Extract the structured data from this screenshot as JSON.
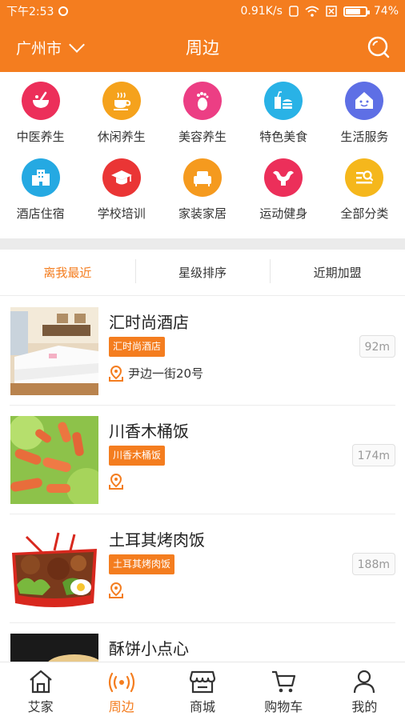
{
  "status_bar": {
    "time": "下午2:53",
    "speed": "0.91K/s",
    "battery": "74%",
    "battery_level": 0.74
  },
  "header": {
    "city": "广州市",
    "title": "周边",
    "search_icon": "search-icon"
  },
  "categories": [
    {
      "label": "中医养生",
      "icon": "bowl-icon",
      "color": "#ec2f5a"
    },
    {
      "label": "休闲养生",
      "icon": "tea-cup-icon",
      "color": "#f5a21c"
    },
    {
      "label": "美容养生",
      "icon": "foot-icon",
      "color": "#ec3e84"
    },
    {
      "label": "特色美食",
      "icon": "burger-drink-icon",
      "color": "#29b2e6"
    },
    {
      "label": "生活服务",
      "icon": "house-face-icon",
      "color": "#5e6fe5"
    },
    {
      "label": "酒店住宿",
      "icon": "building-icon",
      "color": "#25a9e2"
    },
    {
      "label": "学校培训",
      "icon": "graduation-cap-icon",
      "color": "#ea3535"
    },
    {
      "label": "家装家居",
      "icon": "sofa-icon",
      "color": "#f59a1e"
    },
    {
      "label": "运动健身",
      "icon": "muscle-icon",
      "color": "#ec2f5a"
    },
    {
      "label": "全部分类",
      "icon": "list-search-icon",
      "color": "#f5b71c"
    }
  ],
  "sort_tabs": [
    {
      "label": "离我最近",
      "active": true
    },
    {
      "label": "星级排序",
      "active": false
    },
    {
      "label": "近期加盟",
      "active": false
    }
  ],
  "shops": [
    {
      "name": "汇时尚酒店",
      "tag": "汇时尚酒店",
      "address": "尹边一街20号",
      "distance": "92m",
      "image": "hotel-room-photo"
    },
    {
      "name": "川香木桶饭",
      "tag": "川香木桶饭",
      "address": "",
      "distance": "174m",
      "image": "sausage-dish-photo"
    },
    {
      "name": "土耳其烤肉饭",
      "tag": "土耳其烤肉饭",
      "address": "",
      "distance": "188m",
      "image": "kebab-rice-photo"
    },
    {
      "name": "酥饼小点心",
      "tag": "",
      "address": "",
      "distance": "",
      "image": "pastry-photo"
    }
  ],
  "tab_bar": [
    {
      "label": "艾家",
      "icon": "home-icon",
      "active": false
    },
    {
      "label": "周边",
      "icon": "nearby-signal-icon",
      "active": true
    },
    {
      "label": "商城",
      "icon": "store-icon",
      "active": false
    },
    {
      "label": "购物车",
      "icon": "cart-icon",
      "active": false
    },
    {
      "label": "我的",
      "icon": "person-icon",
      "active": false
    }
  ],
  "colors": {
    "accent": "#f47d1f",
    "background": "#ffffff",
    "divider": "#ebebeb"
  }
}
